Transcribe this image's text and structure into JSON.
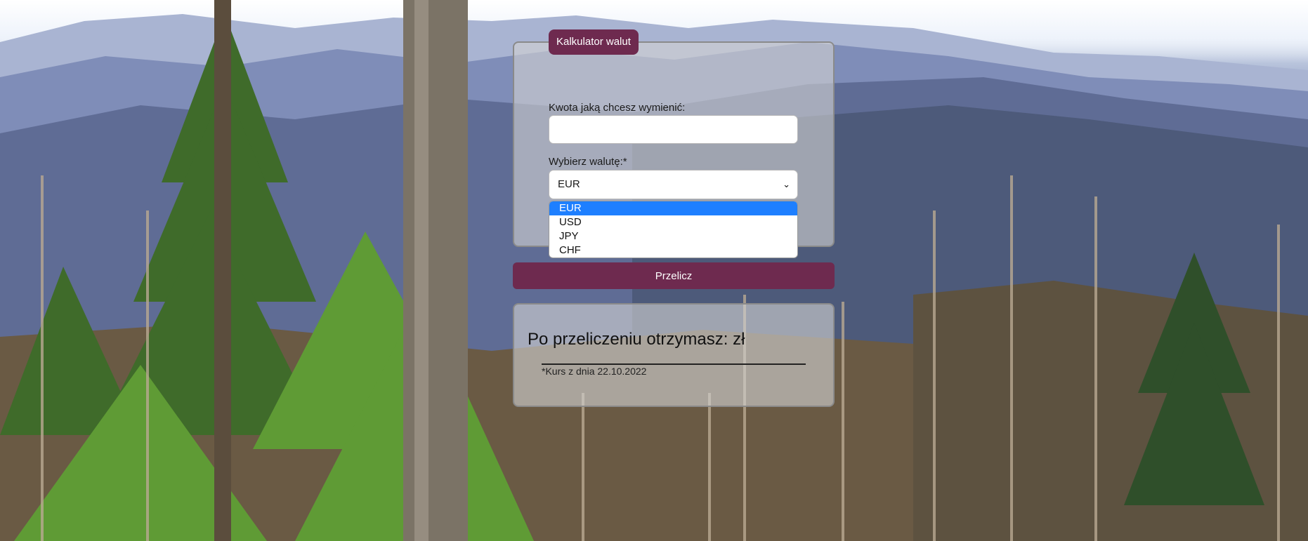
{
  "app": {
    "title": "Kalkulator walut"
  },
  "form": {
    "amount_label": "Kwota jaką chcesz wymienić:",
    "amount_value": "",
    "currency_label": "Wybierz walutę:*",
    "currency_selected": "EUR",
    "currency_options": [
      "EUR",
      "USD",
      "JPY",
      "CHF"
    ],
    "submit_label": "Przelicz"
  },
  "result": {
    "text": "Po przeliczeniu otrzymasz: zł",
    "rate_note": "*Kurs z dnia 22.10.2022"
  },
  "colors": {
    "accent": "#6e2a4f",
    "highlight": "#1e7fff"
  }
}
